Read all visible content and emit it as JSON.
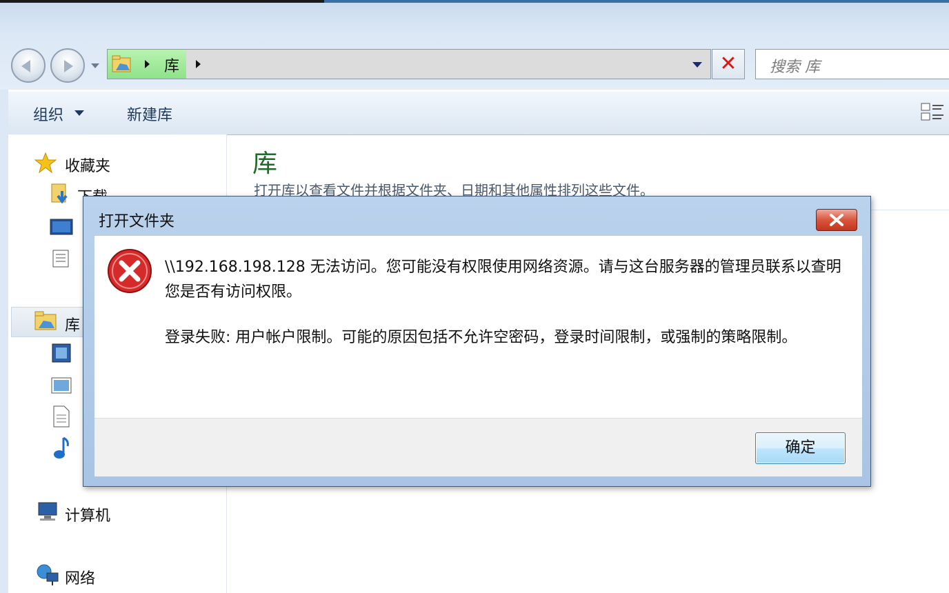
{
  "address_bar": {
    "breadcrumb": "库"
  },
  "search": {
    "placeholder": "搜索 库"
  },
  "toolbar": {
    "organize": "组织",
    "new_library": "新建库"
  },
  "sidebar": {
    "favorites": "收藏夹",
    "favorites_items": [
      "下载"
    ],
    "library": "库",
    "computer": "计算机",
    "network": "网络"
  },
  "main": {
    "title": "库",
    "description": "打开库以查看文件并根据文件夹、日期和其他属性排列这些文件。"
  },
  "dialog": {
    "title": "打开文件夹",
    "message_line1": "\\\\192.168.198.128 无法访问。您可能没有权限使用网络资源。请与这台服务器的管理员联系以查明您是否有访问权限。",
    "message_line2": "登录失败: 用户帐户限制。可能的原因包括不允许空密码，登录时间限制，或强制的策略限制。",
    "ok_button": "确定"
  },
  "colors": {
    "title_bar": "#bad2ec",
    "library_title": "#1f6b2c",
    "error_red": "#d42a2a",
    "close_button": "#c2371f"
  },
  "icons": [
    "back-icon",
    "forward-icon",
    "library-folder-icon",
    "stop-icon",
    "view-options-icon",
    "star-icon",
    "download-folder-icon",
    "desktop-icon",
    "recent-icon",
    "video-icon",
    "picture-icon",
    "document-icon",
    "music-icon",
    "computer-icon",
    "network-icon",
    "error-icon",
    "close-icon"
  ]
}
